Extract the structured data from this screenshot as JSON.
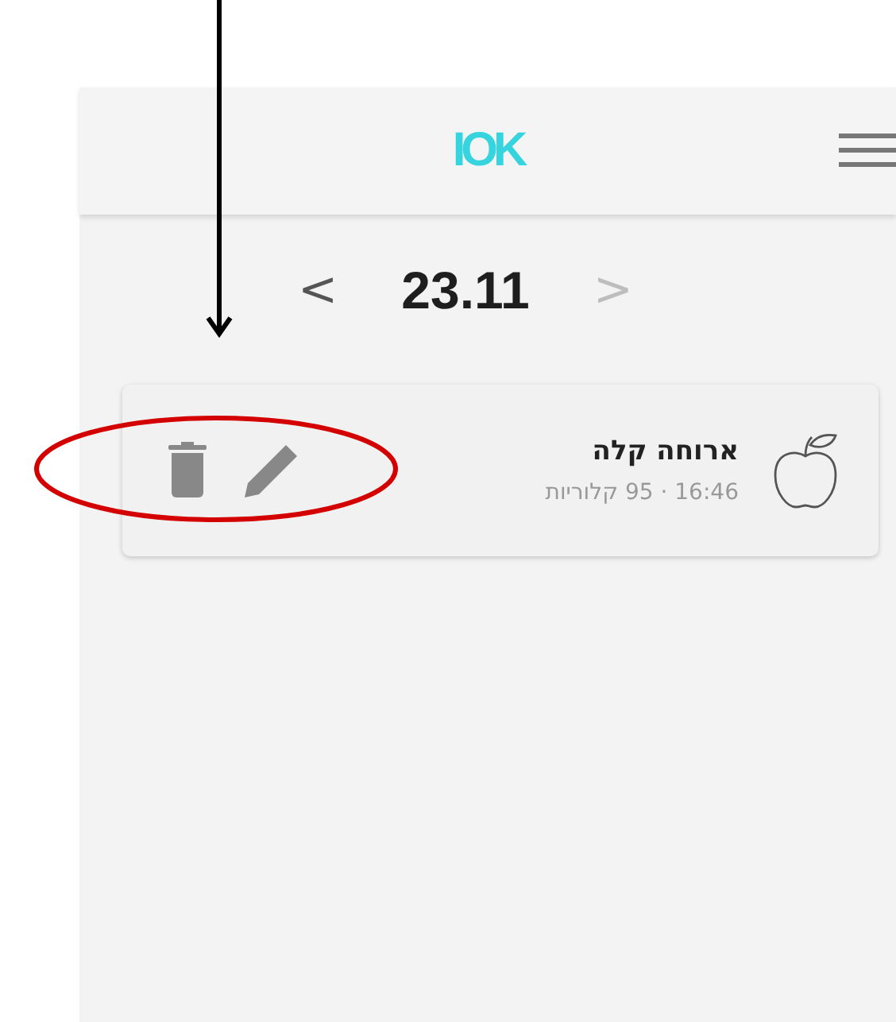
{
  "header": {
    "logo": "IOK"
  },
  "date_nav": {
    "date": "23.11",
    "prev": "<",
    "next": ">",
    "next_disabled": true
  },
  "meals": [
    {
      "title": "ארוחה קלה",
      "subtitle": "16:46 · 95 קלוריות"
    }
  ],
  "annotation": {
    "arrow": true,
    "ellipse": true
  }
}
